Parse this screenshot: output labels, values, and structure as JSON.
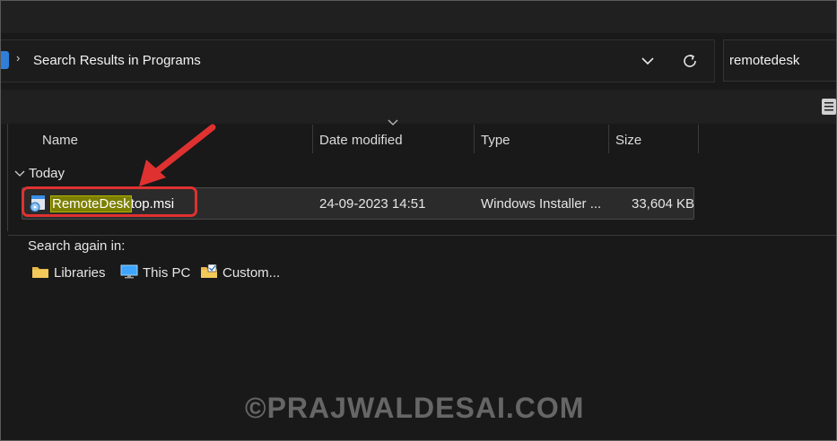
{
  "address_bar": {
    "breadcrumb": "Search Results in Programs",
    "chevron": "›"
  },
  "search_box": {
    "value": "remotedesk"
  },
  "columns": {
    "name": "Name",
    "date_modified": "Date modified",
    "type": "Type",
    "size": "Size"
  },
  "group": {
    "label": "Today"
  },
  "file": {
    "name_highlight": "RemoteDesk",
    "name_rest": "top.msi",
    "date_modified": "24-09-2023 14:51",
    "type": "Windows Installer ...",
    "size": "33,604 KB"
  },
  "search_again": {
    "label": "Search again in:",
    "locations": [
      "Libraries",
      "This PC",
      "Custom..."
    ]
  },
  "watermark": "©PRAJWALDESAI.COM",
  "icons": [
    "folder-icon",
    "chevron-down-icon",
    "refresh-icon",
    "details-view-icon",
    "msi-file-icon",
    "this-pc-icon",
    "custom-folder-icon",
    "red-arrow-annotation"
  ],
  "colors": {
    "background": "#191919",
    "selection": "#2b2b2b",
    "highlight": "#7c7f00",
    "annotation": "#e03131",
    "folder": "#e8b84a"
  }
}
